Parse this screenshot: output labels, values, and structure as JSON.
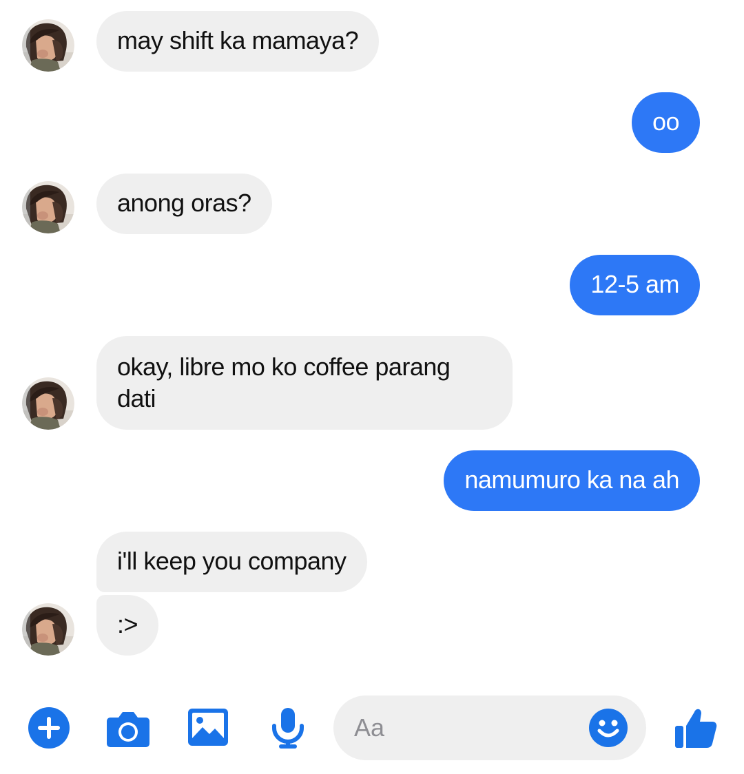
{
  "conversation": {
    "messages": [
      {
        "sender": "them",
        "text": "may shift ka mamaya?"
      },
      {
        "sender": "me",
        "text": "oo"
      },
      {
        "sender": "them",
        "text": "anong oras?"
      },
      {
        "sender": "me",
        "text": "12-5 am"
      },
      {
        "sender": "them",
        "text_line1": "okay, libre mo ko coffee parang",
        "text_line2": "dati"
      },
      {
        "sender": "me",
        "text": "namumuro ka na ah"
      },
      {
        "sender": "them",
        "text": "i'll keep you company"
      },
      {
        "sender": "them",
        "text": ":>"
      }
    ]
  },
  "composer": {
    "placeholder": "Aa",
    "icons": [
      "plus-circle-icon",
      "camera-icon",
      "photo-icon",
      "microphone-icon",
      "emoji-icon",
      "thumbs-up-icon"
    ]
  },
  "colors": {
    "accent": "#2d78f6",
    "incoming_bubble": "#efefef",
    "icon_blue": "#1a73e8"
  }
}
